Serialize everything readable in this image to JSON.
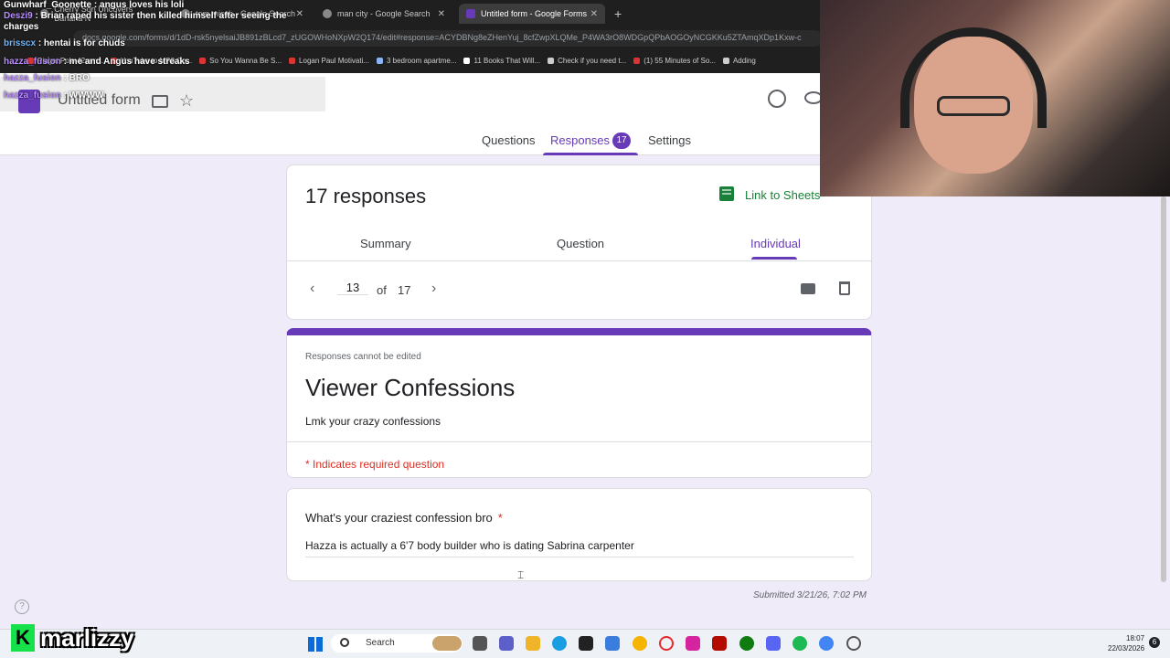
{
  "browser": {
    "tabs": [
      {
        "title": "Cherry Son Uncovers Banana N"
      },
      {
        "title": "tom misch - Google Search"
      },
      {
        "title": "man city - Google Search"
      },
      {
        "title": "Untitled form - Google Forms"
      }
    ],
    "url": "docs.google.com/forms/d/1dD-rsk5nyelsaiJB891zBLcd7_zUGOWHoNXpW2Q174/edit#response=ACYDBNg8eZHenYuj_8cfZwpXLQMe_P4WA3rO8WDGpQPbAOGOyNCGKKu5ZTAmqXDp1Kxw-c",
    "bookmarks": [
      "Piaget Polo 42mm...",
      "YouTube to MP3 Co...",
      "So You Wanna Be S...",
      "Logan Paul Motivati...",
      "3 bedroom apartme...",
      "11 Books That Will...",
      "Check if you need t...",
      "(1) 55 Minutes of So...",
      "Adding"
    ]
  },
  "chat": [
    {
      "user": "Gunwharf_Goonette",
      "msg": ": angus loves his loli",
      "color": "p"
    },
    {
      "user": "Deszi9",
      "msg": ": Brian raped his sister then killed himself after seeing the charges",
      "color": "p"
    },
    {
      "user": "brisscx",
      "msg": ": hentai is for chuds",
      "color": "b"
    },
    {
      "user": "hazza_fusion",
      "msg": ": me and Angus have streaks",
      "color": "p"
    },
    {
      "user": "hazza_fusion",
      "msg": ": BRO",
      "color": "p"
    },
    {
      "user": "hazza_fusion",
      "msg": ": WWWW",
      "color": "p"
    }
  ],
  "form": {
    "title": "Untitled form",
    "tabs": {
      "questions": "Questions",
      "responses": "Responses",
      "responses_count": "17",
      "settings": "Settings"
    },
    "responses_heading": "17 responses",
    "sheets_link": "Link to Sheets",
    "subtabs": {
      "summary": "Summary",
      "question": "Question",
      "individual": "Individual"
    },
    "pager": {
      "current": "13",
      "of": "of",
      "total": "17"
    },
    "cannot_edit": "Responses cannot be edited",
    "heading": "Viewer Confessions",
    "description": "Lmk your crazy confessions",
    "required_note": "* Indicates required question",
    "question": "What's your craziest confession bro",
    "required_star": "*",
    "answer": "Hazza is actually a 6'7 body builder who is dating Sabrina carpenter",
    "submitted": "Submitted 3/21/26, 7:02 PM",
    "help": "?"
  },
  "stream": {
    "logo": "K",
    "name": "marlizzy"
  },
  "taskbar": {
    "search": "Search",
    "time": "18:07",
    "date": "22/03/2026",
    "badge": "6"
  },
  "colors": {
    "accent": "#673ab7",
    "required": "#d93025",
    "sheets": "#188038"
  }
}
